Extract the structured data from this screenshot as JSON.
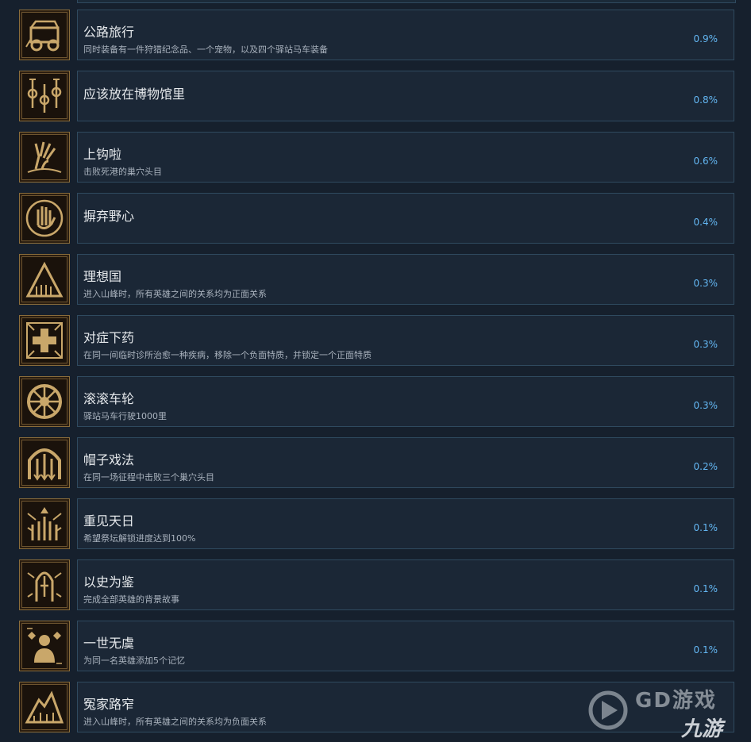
{
  "colors": {
    "background": "#16202d",
    "card_bg": "#1b2736",
    "card_border": "#2f4a5f",
    "percent": "#63b6f2",
    "title": "#e6e9ec",
    "description": "#a9b2bd",
    "icon_gold": "#c9a76a"
  },
  "achievements": [
    {
      "title": "公路旅行",
      "description": "同时装备有一件狩猎纪念品、一个宠物，以及四个驿站马车装备",
      "percent": "0.9%",
      "icon": "wagon-icon"
    },
    {
      "title": "应该放在博物馆里",
      "description": "",
      "percent": "0.8%",
      "icon": "relics-icon"
    },
    {
      "title": "上钩啦",
      "description": "击败死港的巢穴头目",
      "percent": "0.6%",
      "icon": "claw-hand-icon"
    },
    {
      "title": "摒弃野心",
      "description": "",
      "percent": "0.4%",
      "icon": "open-palm-icon"
    },
    {
      "title": "理想国",
      "description": "进入山峰时，所有英雄之间的关系均为正面关系",
      "percent": "0.3%",
      "icon": "mountain-icon"
    },
    {
      "title": "对症下药",
      "description": "在同一间临时诊所治愈一种疾病，移除一个负面特质，并锁定一个正面特质",
      "percent": "0.3%",
      "icon": "medical-cross-icon"
    },
    {
      "title": "滚滚车轮",
      "description": "驿站马车行驶1000里",
      "percent": "0.3%",
      "icon": "wheel-icon"
    },
    {
      "title": "帽子戏法",
      "description": "在同一场征程中击败三个巢穴头目",
      "percent": "0.2%",
      "icon": "gate-icon"
    },
    {
      "title": "重见天日",
      "description": "希望祭坛解锁进度达到100%",
      "percent": "0.1%",
      "icon": "altar-icon"
    },
    {
      "title": "以史为鉴",
      "description": "完成全部英雄的背景故事",
      "percent": "0.1%",
      "icon": "shrine-icon"
    },
    {
      "title": "一世无虞",
      "description": "为同一名英雄添加5个记忆",
      "percent": "0.1%",
      "icon": "figure-icon"
    },
    {
      "title": "冤家路窄",
      "description": "进入山峰时，所有英雄之间的关系均为负面关系",
      "percent": "",
      "icon": "dark-mountain-icon"
    }
  ],
  "watermark": {
    "top_text": "GD游戏",
    "bottom_text": "九游"
  }
}
